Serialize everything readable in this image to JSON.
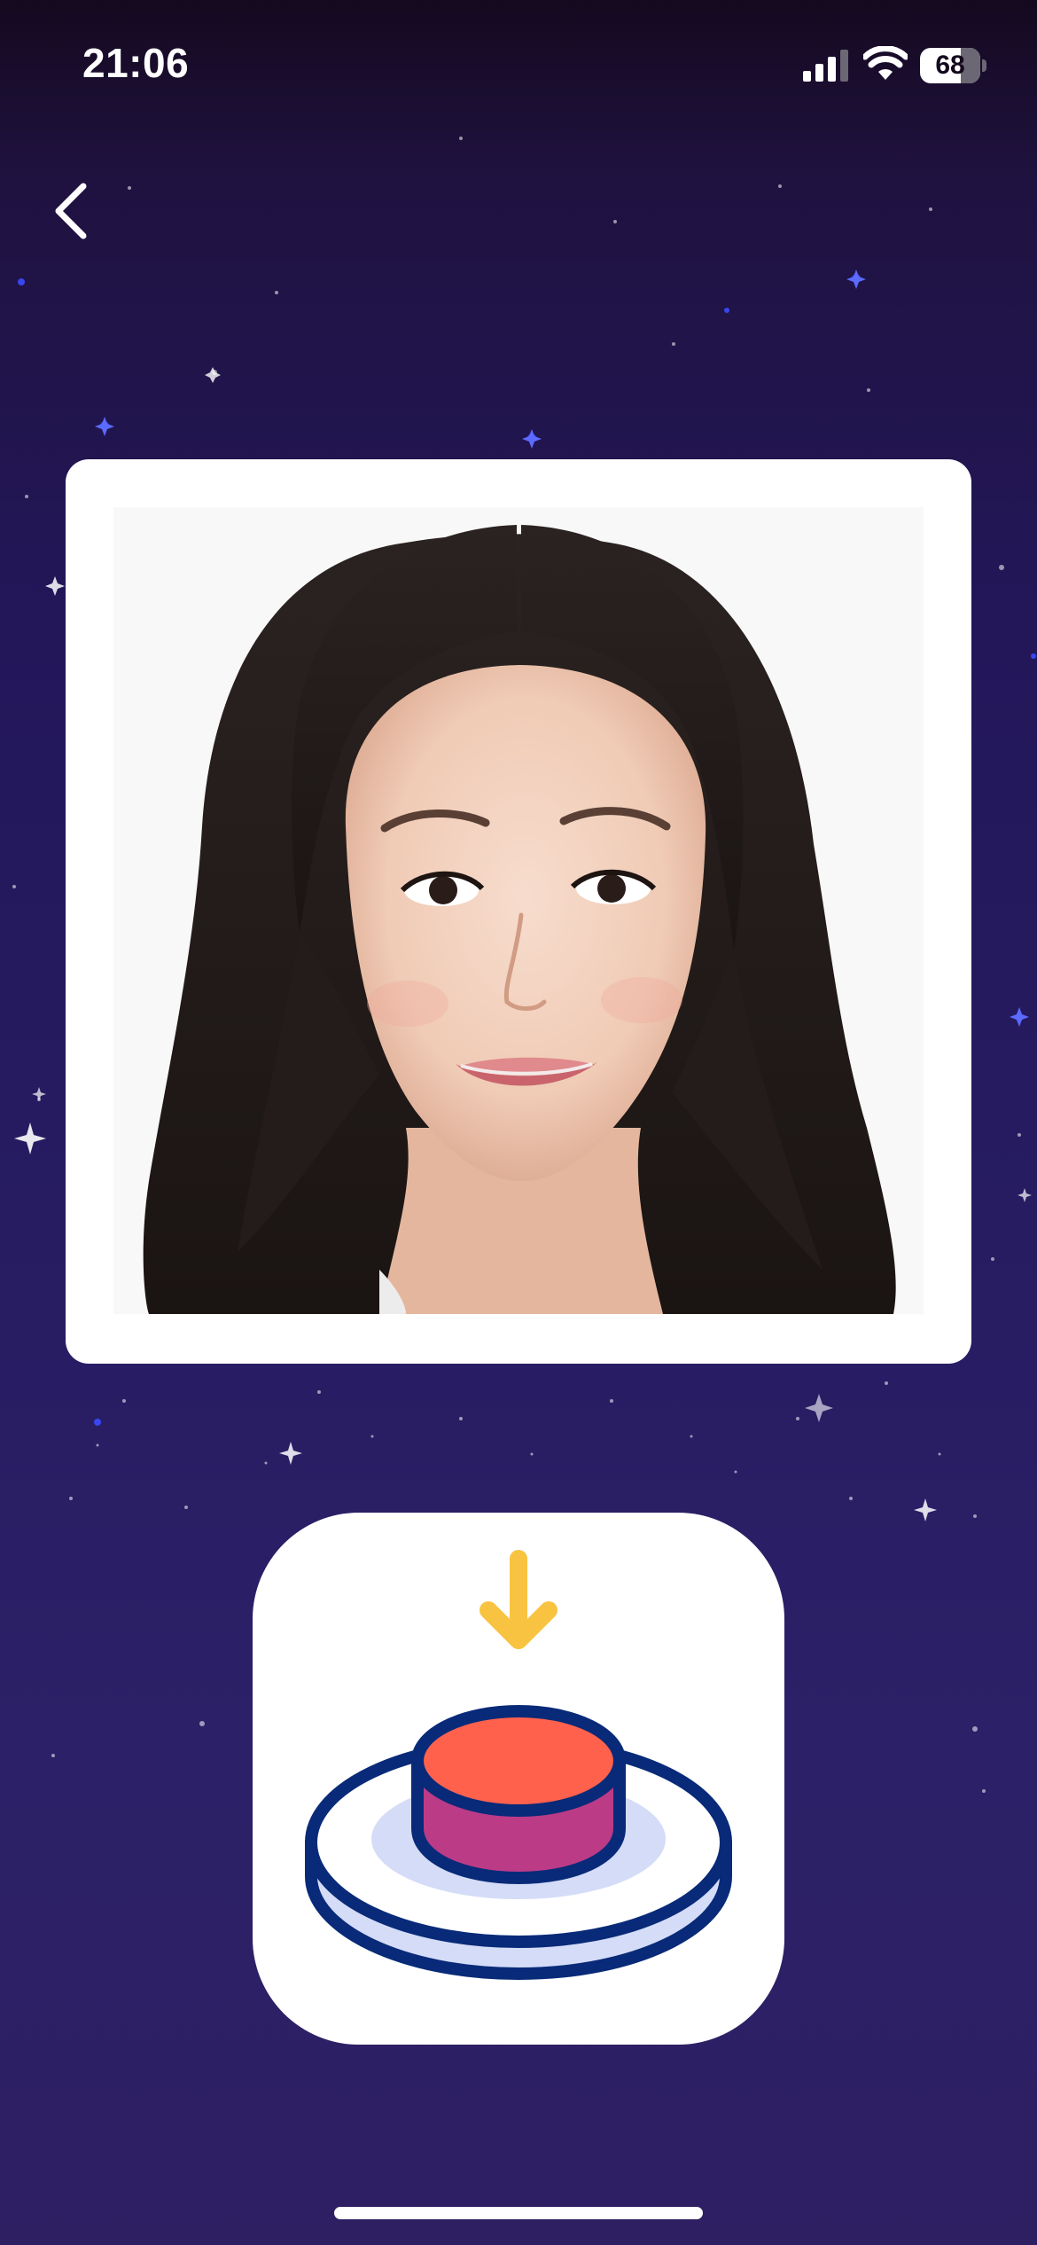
{
  "status_bar": {
    "time": "21:06",
    "battery_level": "68",
    "icons": [
      "signal-icon",
      "wifi-icon",
      "battery-icon"
    ]
  },
  "navigation": {
    "back_icon": "chevron-left-icon"
  },
  "main": {
    "photo_subject": "portrait-photo",
    "app_icon": "button-press-icon"
  },
  "colors": {
    "background_top": "#15091f",
    "background_bottom": "#2e1f63",
    "card": "#ffffff",
    "arrow_yellow": "#f8c341",
    "button_red": "#ff614d",
    "button_magenta": "#bc3b87",
    "outline_navy": "#082a78",
    "base_lavender": "#d4dcf7"
  }
}
